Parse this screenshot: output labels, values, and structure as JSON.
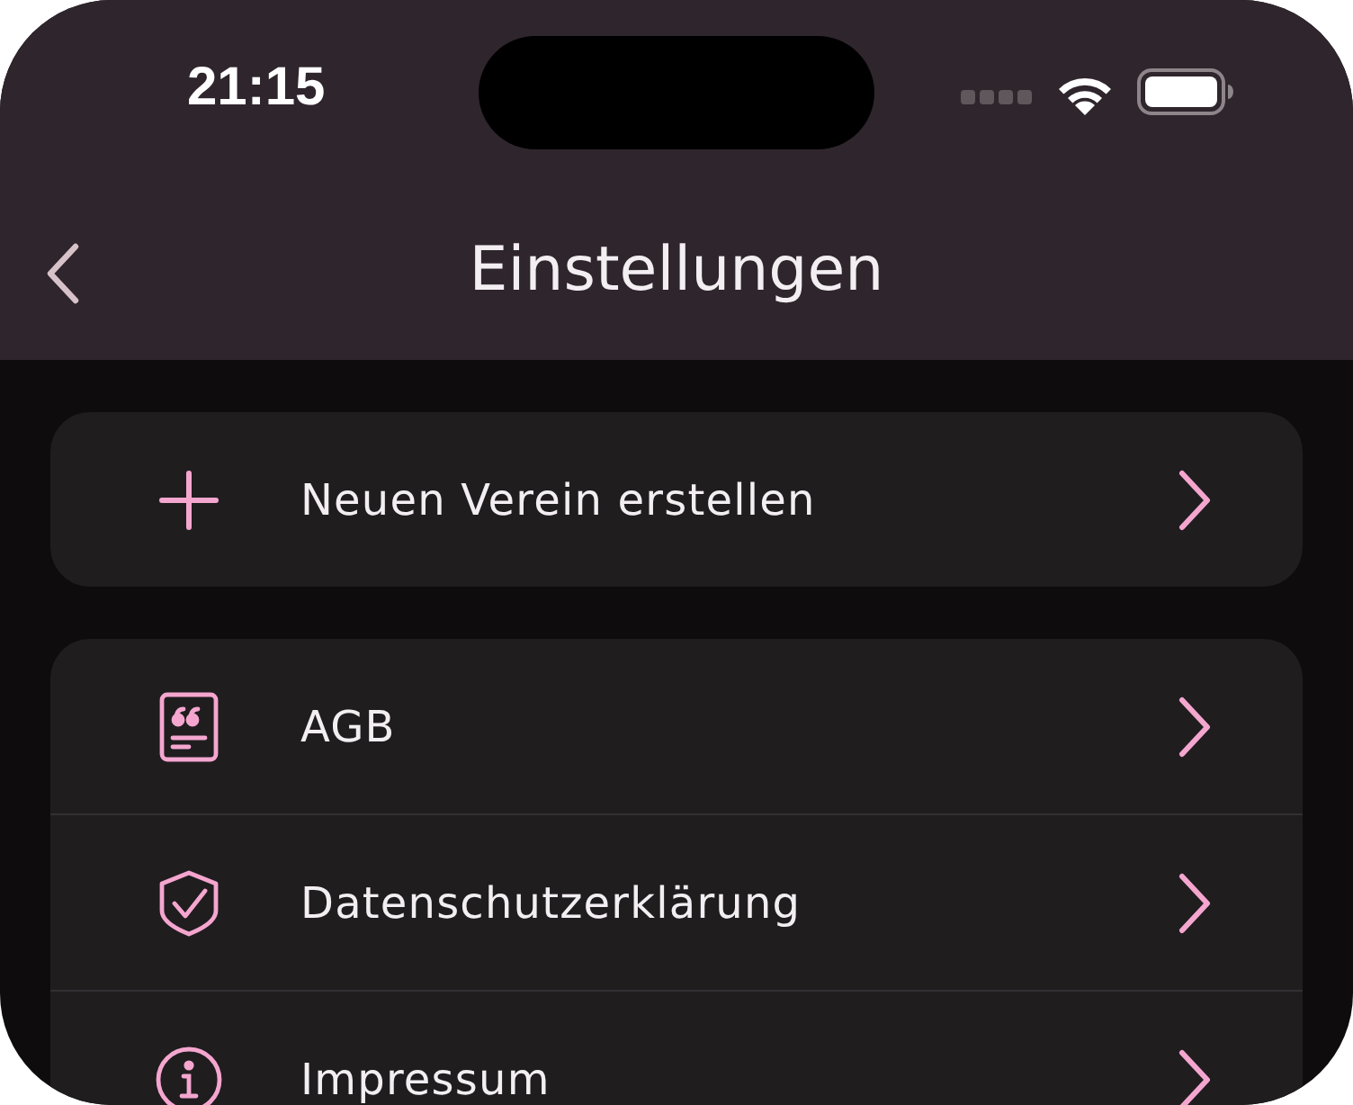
{
  "status_bar": {
    "time": "21:15"
  },
  "nav": {
    "title": "Einstellungen"
  },
  "groups": [
    {
      "items": [
        {
          "kind": "plus",
          "label": "Neuen Verein erstellen"
        }
      ]
    },
    {
      "items": [
        {
          "kind": "document",
          "label": "AGB"
        },
        {
          "kind": "shield",
          "label": "Datenschutzerklärung"
        },
        {
          "kind": "info",
          "label": "Impressum"
        }
      ]
    }
  ]
}
